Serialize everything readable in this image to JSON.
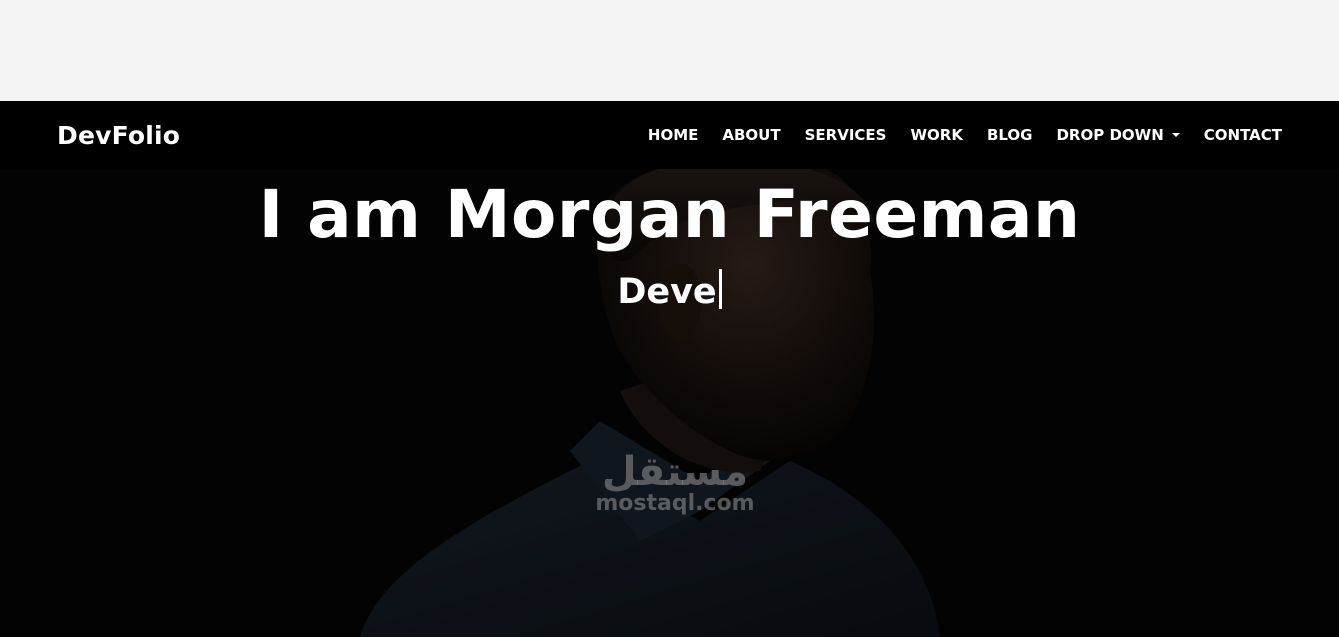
{
  "brand": "DevFolio",
  "nav": {
    "items": [
      {
        "label": "HOME"
      },
      {
        "label": "ABOUT"
      },
      {
        "label": "SERVICES"
      },
      {
        "label": "WORK"
      },
      {
        "label": "BLOG"
      },
      {
        "label": "DROP DOWN"
      },
      {
        "label": "CONTACT"
      }
    ]
  },
  "hero": {
    "title": "I am Morgan Freeman",
    "typed_text": "Deve"
  },
  "watermark": {
    "arabic": "مستقل",
    "text": "mostaql.com"
  },
  "colors": {
    "navbar_bg": "#000000",
    "hero_bg": "#050505",
    "text": "#ffffff",
    "page_bg": "#f4f4f4"
  }
}
